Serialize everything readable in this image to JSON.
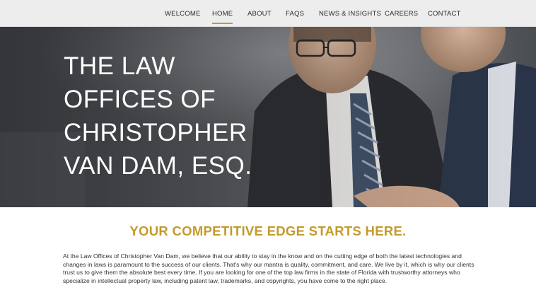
{
  "nav": {
    "items": [
      {
        "label": "WELCOME",
        "active": false
      },
      {
        "label": "HOME",
        "active": true
      },
      {
        "label": "ABOUT",
        "active": false
      },
      {
        "label": "FAQS",
        "active": false
      },
      {
        "label": "NEWS & INSIGHTS",
        "active": false
      },
      {
        "label": "CAREERS",
        "active": false
      },
      {
        "label": "CONTACT",
        "active": false
      }
    ]
  },
  "hero": {
    "title_lines": [
      "THE LAW",
      "OFFICES OF",
      "CHRISTOPHER",
      "VAN DAM, ESQ."
    ]
  },
  "main": {
    "tagline": "YOUR COMPETITIVE EDGE STARTS HERE.",
    "body": "At the Law Offices of Christopher Van Dam, we believe that our ability to stay in the know and on the cutting edge of both the latest technologies and changes in laws is paramount to the success of our clients.  That's why our mantra is quality, commitment, and care.  We live by it, which is why our clients trust us to give them the absolute best every time.    If you are looking for one of the top law firms in the state of Florida with trustworthy attorneys who specialize in intellectual property law, including patent law, trademarks, and copyrights, you have come to the right place."
  },
  "colors": {
    "accent": "#c39a2b",
    "nav_bg": "#ededed",
    "text": "#333333"
  }
}
